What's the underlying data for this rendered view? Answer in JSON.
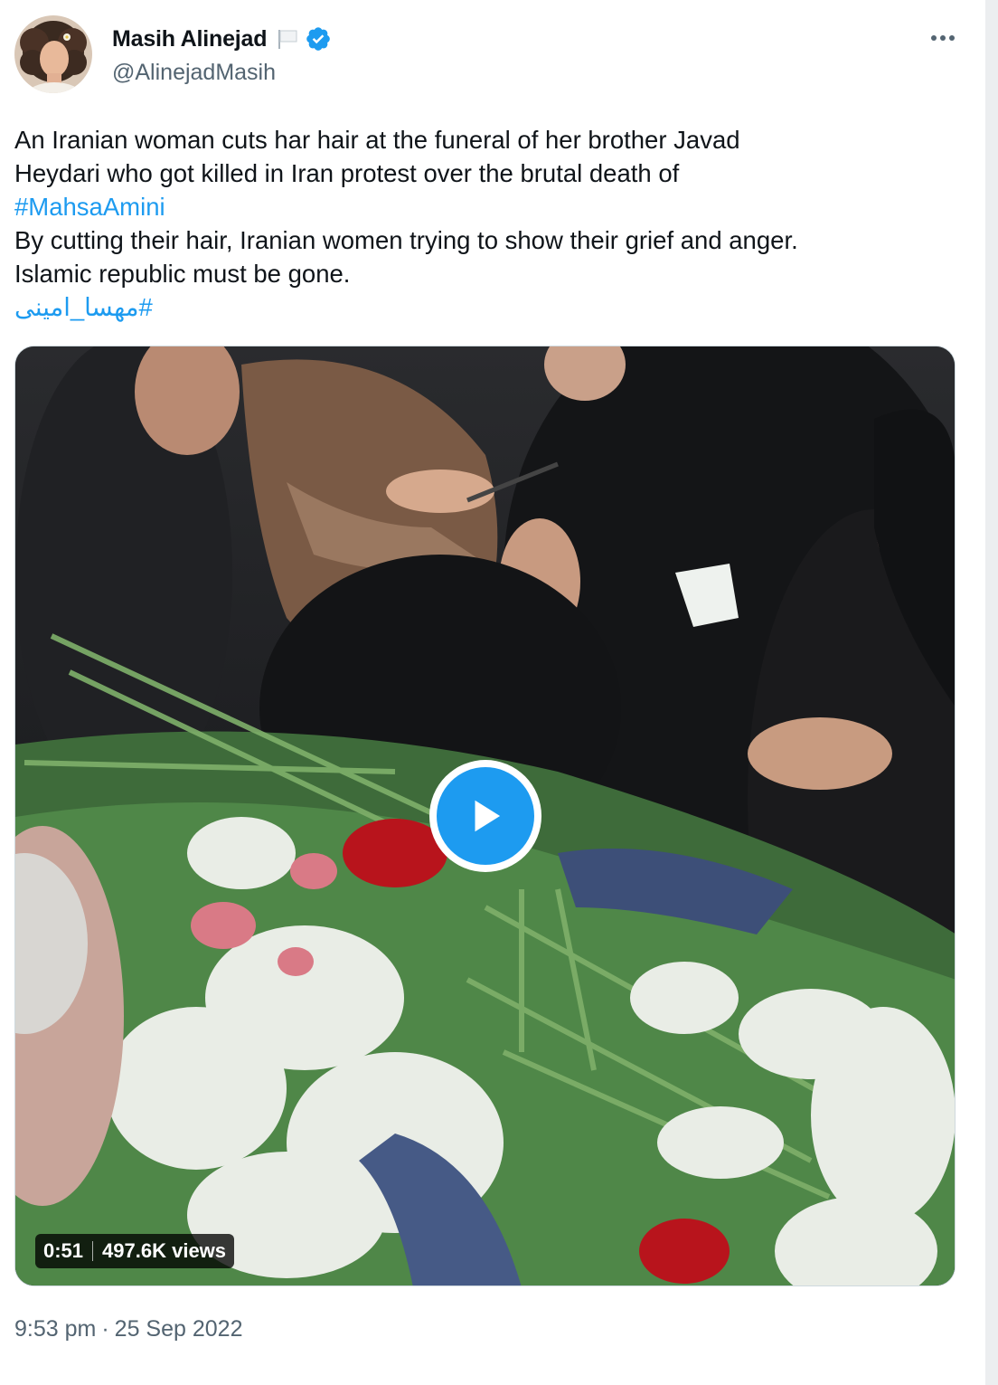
{
  "author": {
    "display_name": "Masih Alinejad",
    "handle": "@AlinejadMasih"
  },
  "tweet": {
    "lines": [
      "An Iranian woman cuts har hair at the funeral of her brother Javad",
      "Heydari who got killed in Iran protest over the brutal death of"
    ],
    "hashtag_1": "#MahsaAmini",
    "lines_2": [
      "By cutting their hair, Iranian women trying to show their grief and anger.",
      "Islamic republic must be gone."
    ],
    "hashtag_2": "#مهسا_امینی"
  },
  "media": {
    "duration": "0:51",
    "views": "497.6K views"
  },
  "meta": {
    "time": "9:53 pm",
    "separator": "·",
    "date": "25 Sep 2022"
  },
  "icons": {
    "verified": "verified-badge-icon",
    "flag": "white-flag-icon",
    "more": "more-options-icon",
    "play": "play-icon"
  },
  "colors": {
    "link": "#1d9bf0",
    "secondary_text": "#536471",
    "primary_text": "#0f1419"
  }
}
